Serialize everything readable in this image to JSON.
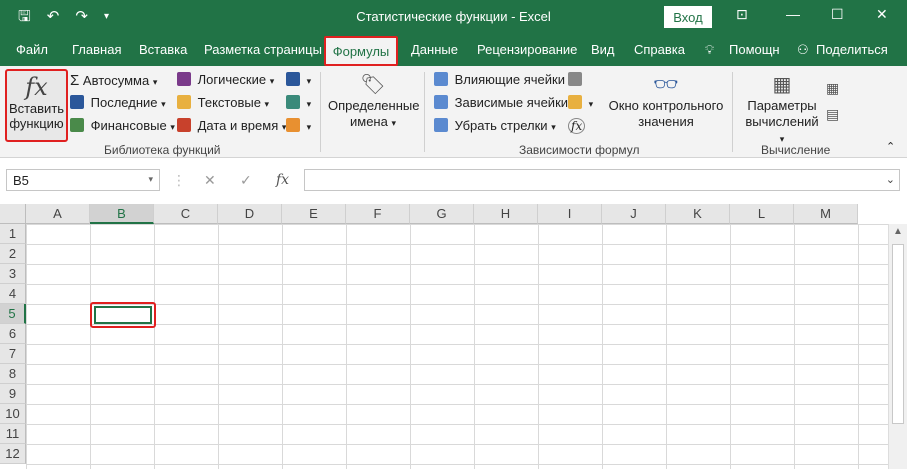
{
  "window": {
    "title": "Статистические функции  -  Excel",
    "login_label": "Вход"
  },
  "tabs": [
    "Файл",
    "Главная",
    "Вставка",
    "Разметка страницы",
    "Формулы",
    "Данные",
    "Рецензирование",
    "Вид",
    "Справка",
    "Помощн",
    "Поделиться"
  ],
  "ribbon": {
    "insert_function": {
      "symbol": "fx",
      "line1": "Вставить",
      "line2": "функцию"
    },
    "library": {
      "col1": [
        "Автосумма",
        "Последние",
        "Финансовые"
      ],
      "col2": [
        "Логические",
        "Текстовые",
        "Дата и время"
      ],
      "label": "Библиотека функций"
    },
    "defined_names": {
      "line1": "Определенные",
      "line2": "имена"
    },
    "audit": {
      "items": [
        "Влияющие ячейки",
        "Зависимые ячейки",
        "Убрать стрелки"
      ],
      "watch_line1": "Окно контрольного",
      "watch_line2": "значения",
      "label": "Зависимости формул"
    },
    "calc": {
      "line1": "Параметры",
      "line2": "вычислений",
      "label": "Вычисление"
    }
  },
  "formula_bar": {
    "name_box": "B5",
    "cancel": "✕",
    "enter": "✓",
    "fx": "fx",
    "value": ""
  },
  "grid": {
    "columns": [
      "A",
      "B",
      "C",
      "D",
      "E",
      "F",
      "G",
      "H",
      "I",
      "J",
      "K",
      "L",
      "M"
    ],
    "rows": [
      "1",
      "2",
      "3",
      "4",
      "5",
      "6",
      "7",
      "8",
      "9",
      "10",
      "11",
      "12"
    ],
    "selected_column": "B",
    "selected_row": "5"
  },
  "colors": {
    "accent": "#217346",
    "highlight": "#e02020"
  }
}
